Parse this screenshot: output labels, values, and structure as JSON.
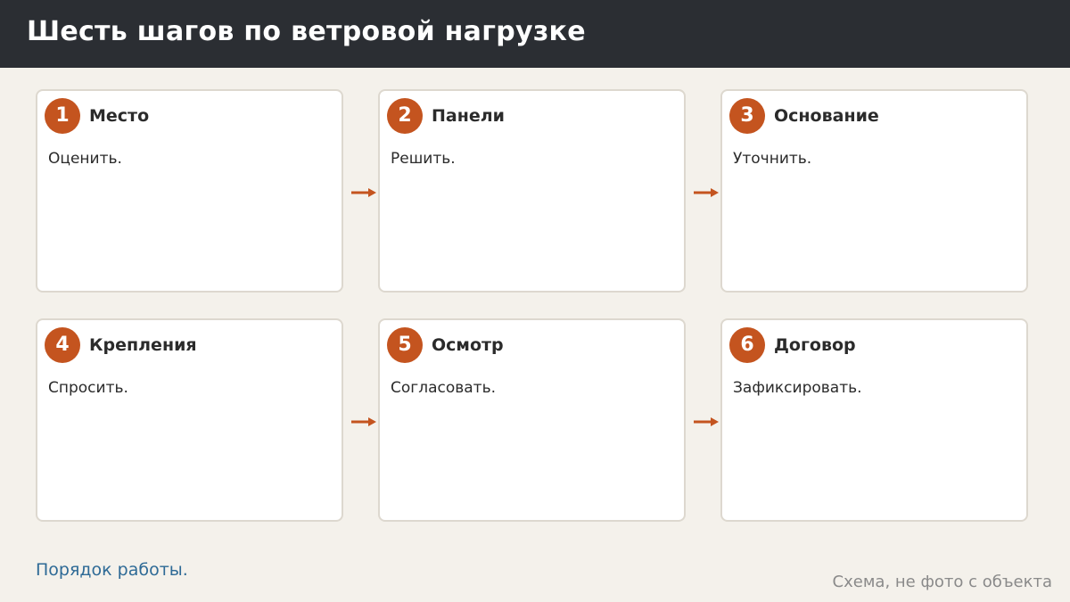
{
  "title": "Шесть шагов по ветровой нагрузке",
  "steps": [
    {
      "number": "1",
      "title": "Место",
      "text": "Оценить."
    },
    {
      "number": "2",
      "title": "Панели",
      "text": "Решить."
    },
    {
      "number": "3",
      "title": "Основание",
      "text": "Уточнить."
    },
    {
      "number": "4",
      "title": "Крепления",
      "text": "Спросить."
    },
    {
      "number": "5",
      "title": "Осмотр",
      "text": "Согласовать."
    },
    {
      "number": "6",
      "title": "Договор",
      "text": "Зафиксировать."
    }
  ],
  "footer": {
    "link": "Порядок работы.",
    "note": "Схема, не фото с объекта"
  },
  "colors": {
    "accent": "#c4541f",
    "header_bg": "#2b2e33",
    "page_bg": "#f4f1eb",
    "link": "#2e6a96"
  }
}
